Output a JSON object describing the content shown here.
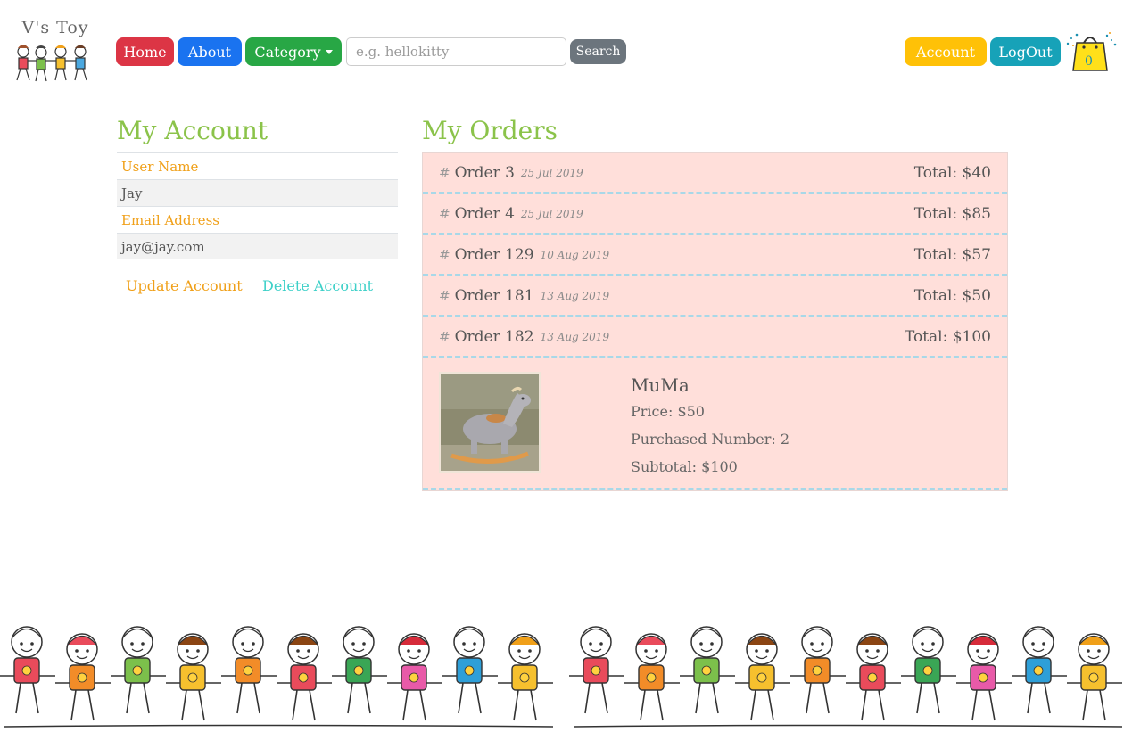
{
  "header": {
    "logo_text": "V's Toy",
    "nav": {
      "home": "Home",
      "about": "About",
      "category": "Category"
    },
    "search": {
      "placeholder": "e.g. hellokitty",
      "button": "Search"
    },
    "account": "Account",
    "logout": "LogOut",
    "cart_count": "0"
  },
  "account": {
    "title": "My Account",
    "username_label": "User Name",
    "username": "Jay",
    "email_label": "Email Address",
    "email": "jay@jay.com",
    "update_link": "Update Account",
    "delete_link": "Delete Account"
  },
  "orders": {
    "title": "My Orders",
    "list": [
      {
        "hash": "#",
        "name": "Order 3",
        "date": "25 Jul 2019",
        "total": "Total: $40"
      },
      {
        "hash": "#",
        "name": "Order 4",
        "date": "25 Jul 2019",
        "total": "Total: $85"
      },
      {
        "hash": "#",
        "name": "Order 129",
        "date": "10 Aug 2019",
        "total": "Total: $57"
      },
      {
        "hash": "#",
        "name": "Order 181",
        "date": "13 Aug 2019",
        "total": "Total: $50"
      },
      {
        "hash": "#",
        "name": "Order 182",
        "date": "13 Aug 2019",
        "total": "Total: $100"
      }
    ],
    "expanded_item": {
      "name": "MuMa",
      "price": "Price: $50",
      "quantity": "Purchased Number: 2",
      "subtotal": "Subtotal: $100"
    }
  },
  "colors": {
    "accent_green": "#8bc34a",
    "label_orange": "#f0a019",
    "order_bg": "#ffdfda",
    "dash_blue": "#a8d8e8"
  }
}
